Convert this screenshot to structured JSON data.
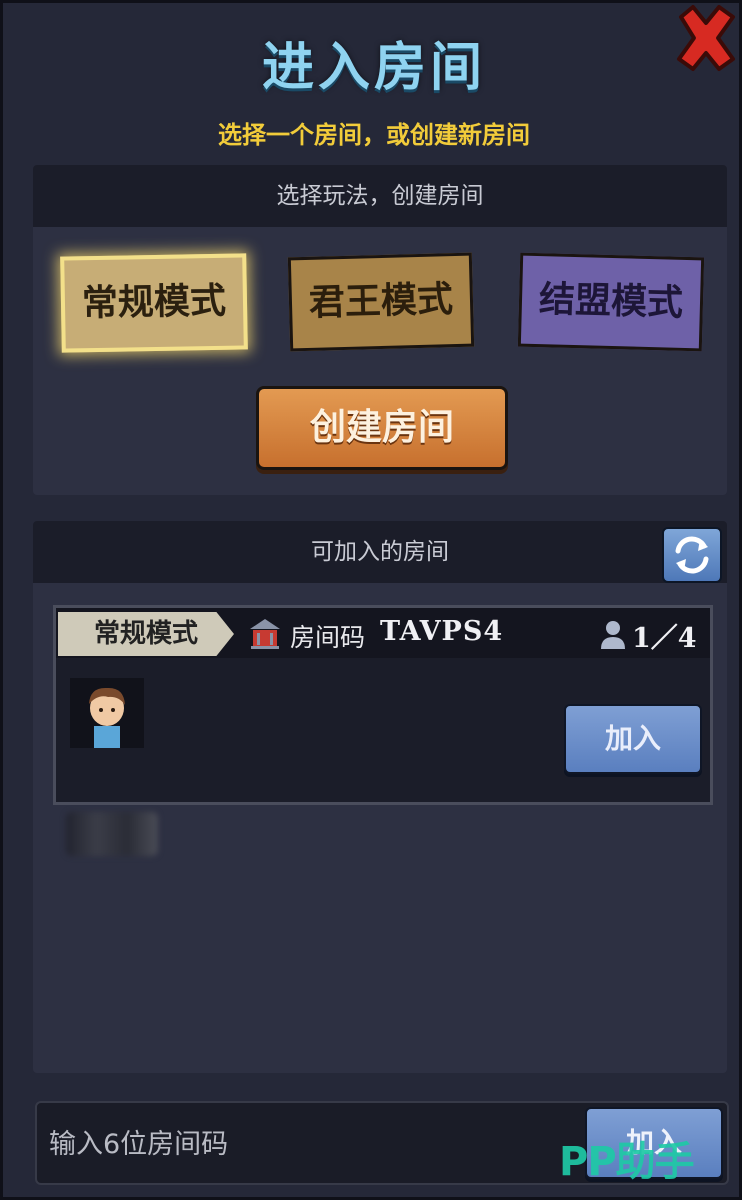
{
  "dialog": {
    "title": "进入房间",
    "subtitle": "选择一个房间，或创建新房间"
  },
  "create_section": {
    "header": "选择玩法，创建房间",
    "modes": [
      {
        "label": "常规模式",
        "selected": true,
        "color": "#c7ad76"
      },
      {
        "label": "君王模式",
        "selected": false,
        "color": "#a88449"
      },
      {
        "label": "结盟模式",
        "selected": false,
        "color": "#6e61a8"
      }
    ],
    "create_button": "创建房间"
  },
  "rooms_section": {
    "header": "可加入的房间",
    "refresh_icon": "refresh-icon",
    "rooms": [
      {
        "mode": "常规模式",
        "code_label": "房间码",
        "code": "TAVPS4",
        "players": "1／4",
        "join_label": "加入"
      }
    ]
  },
  "code_entry": {
    "placeholder": "输入6位房间码",
    "join_label": "加入"
  },
  "watermark": "PP助手",
  "colors": {
    "title": "#8fd3f0",
    "subtitle": "#f2cc3a",
    "button_blue": "#5a7fbf",
    "button_orange": "#c7702e",
    "close_red": "#d72a22"
  }
}
